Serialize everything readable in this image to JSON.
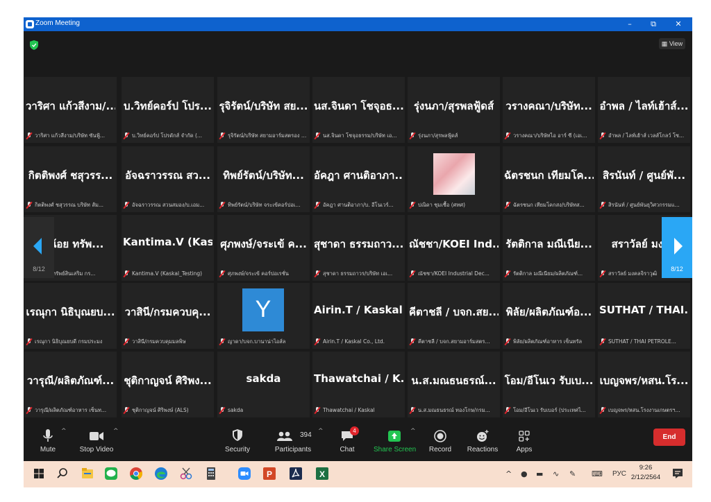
{
  "window": {
    "title": "Zoom Meeting",
    "controls": [
      "–",
      "⧉",
      "✕"
    ]
  },
  "topbar": {
    "view_label": "View"
  },
  "pagination": {
    "left_label": "8/12",
    "right_label": "8/12"
  },
  "tiles": [
    [
      {
        "name": "วาริศา แก้วสีงาม/...",
        "label": "วาริศา แก้วสีงาม/บริษัท ซันฟู้..."
      },
      {
        "name": "บ.วิทย์คอร์ป โปร...",
        "label": "บ.วิทย์คอร์ป โปรดักส์ จำกัด (..."
      },
      {
        "name": "รุจิรัตน์/บริษัท สย...",
        "label": "รุจิรัตน์/บริษัท สยามอาร์มสตรอง จ..."
      },
      {
        "name": "นส.จินดา โชจุอธ...",
        "label": "นส.จินดา โชจุอธรรม/บริษัท เอ..."
      },
      {
        "name": "รุ่งนภา/สุรพลฟู้ดส์",
        "label": "รุ่งนภา/สุรพลฟู้ดส์"
      },
      {
        "name": "วรางคณา/บริษัท...",
        "label": "วรางคณา/บริษัทไอ อาร์ ซี (เอเ..."
      },
      {
        "name": "อำพล / ไลท์เฮ้าส์...",
        "label": "อำพล / ไลท์เฮ้าส์ เวลส์โกลว์ โซ..."
      }
    ],
    [
      {
        "name": "กิตติพงศ์ ชสุวรร...",
        "label": "กิตติพงศ์ ชสุวรรณ บริษัท ส้ม..."
      },
      {
        "name": "อัจฉราวรรณ สว...",
        "label": "อัจฉราวรรณ สวนสมอง/บ.เอม..."
      },
      {
        "name": "ทิพย์รัตน์/บริษัท...",
        "label": "ทิพย์รัตน์/บริษัท จระเข้คอร์ปอเ..."
      },
      {
        "name": "อัคฎา ศานติอาภา...",
        "label": "อัคฎา ศานติอาภา/บ. อีโนเวร์..."
      },
      {
        "name": "",
        "label": "ปณิดา ชุมเชื้อ (ศทศ)",
        "photo": true
      },
      {
        "name": "ฉัตรชนก เทียมโค...",
        "label": "ฉัตรชนก เทียมโคกสง/บริษัทส..."
      },
      {
        "name": "สิรนันท์ / ศูนย์พั...",
        "label": "สิรนันท์ / ศูนย์พันธุวิศวกรรมแ..."
      }
    ],
    [
      {
        "name": "กาน้อย ทรัพ...",
        "label": "กาน้อย ทรัพย์สินเสริม กร..."
      },
      {
        "name": "Kantima.V (Kas...",
        "label": "Kantima.V (Kaskal_Testing)"
      },
      {
        "name": "ศุภพงษ์/จระเข้ ค...",
        "label": "ศุภพงษ์/จระเข้ คอร์ปอเรชั่น"
      },
      {
        "name": "สุชาดา ธรรมถาว...",
        "label": "สุชาดา ธรรมถาวร/บริษัท เอเ..."
      },
      {
        "name": "ณัชชา/KOEI Ind...",
        "label": "ณัชชา/KOEI Industrial Dec..."
      },
      {
        "name": "รัตติกาล มณีเนีย...",
        "label": "รัตติกาล มณีเนียม/ผลิตภัณฑ์..."
      },
      {
        "name": "สราวัลย์ มงคล",
        "label": "สราวัลย์ มงคลจิราวุฒิ"
      }
    ],
    [
      {
        "name": "เรณุกา นิธิบุณยบ...",
        "label": "เรณุกา นิธิบุณยบดี กรมประมง"
      },
      {
        "name": "วาสินี/กรมควบคุ...",
        "label": "วาสินี/กรมควบคุมมลพิษ"
      },
      {
        "name": "",
        "label": "ญาดา/บจก.บานาน่าไอส์ล",
        "avatar_letter": "Y"
      },
      {
        "name": "Airin.T / Kaskal...",
        "label": "Airin.T / Kaskal Co., Ltd."
      },
      {
        "name": "คีตาชลี / บจก.สย...",
        "label": "คีตาชลี / บจก.สยามอาร์มสตร..."
      },
      {
        "name": "พิลัย/ผลิตภัณฑ์อ...",
        "label": "พิลัย/ผลิตภัณฑ์อาหาร เซ็นทรัล"
      },
      {
        "name": "SUTHAT / THAI...",
        "label": "SUTHAT / THAI PETROLE..."
      }
    ],
    [
      {
        "name": "วารุณี/ผลิตภัณฑ์...",
        "label": "วารุณี/ผลิตภัณฑ์อาหาร เซ็นท..."
      },
      {
        "name": "ชุติกาญจน์ ศิริพง...",
        "label": "ชุติกาญจน์ ศิริพงษ์ (ALS)"
      },
      {
        "name": "sakda",
        "label": "sakda"
      },
      {
        "name": "Thawatchai / K...",
        "label": "Thawatchai / Kaskal"
      },
      {
        "name": "น.ส.มณธนธรณ์...",
        "label": "น.ส.มณธนธรณ์ ทองโกษ/กรม..."
      },
      {
        "name": "โอม/อีโนเว รับเบ...",
        "label": "โอม/อีโนเว รับเบอร์ (ประเทศไ..."
      },
      {
        "name": "เบญจพร/หสน.โร...",
        "label": "เบญจพร/หสน.โรงงานเกษตรฯ..."
      }
    ]
  ],
  "controls": {
    "mute": "Mute",
    "stop_video": "Stop Video",
    "security": "Security",
    "participants": "Participants",
    "participants_count": "394",
    "chat": "Chat",
    "chat_badge": "4",
    "share_screen": "Share Screen",
    "record": "Record",
    "reactions": "Reactions",
    "apps": "Apps",
    "end": "End"
  },
  "taskbar": {
    "language": "РУС",
    "time": "9:26",
    "date": "2/12/2564"
  },
  "colors": {
    "titlebar": "#0e62ce",
    "share_green": "#23c552",
    "end_red": "#d62d2d",
    "page_arrow_blue": "#2aa7f5",
    "taskbar": "#f8dfcf"
  }
}
